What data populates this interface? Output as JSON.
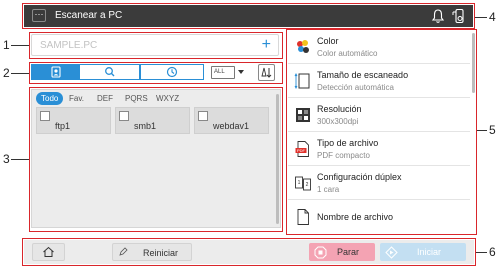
{
  "header": {
    "menu_glyph": "···",
    "title": "Escanear  a  PC"
  },
  "destination": {
    "value": "SAMPLE.PC",
    "add_glyph": "+"
  },
  "toolbar": {
    "tabs": [
      {
        "icon": "address-book-icon",
        "active": true
      },
      {
        "icon": "search-icon",
        "active": false
      },
      {
        "icon": "history-clock-icon",
        "active": false
      }
    ],
    "filter_dropdown": "ALL"
  },
  "filters": [
    "Todo",
    "Fav.",
    "DEF",
    "PQRS",
    "WXYZ"
  ],
  "destinations": [
    "ftp1",
    "smb1",
    "webdav1"
  ],
  "settings": [
    {
      "icon": "color-icon",
      "title": "Color",
      "value": "Color automático"
    },
    {
      "icon": "scan-size-icon",
      "title": "Tamaño de escaneado",
      "value": "Detección automática"
    },
    {
      "icon": "resolution-icon",
      "title": "Resolución",
      "value": "300x300dpi"
    },
    {
      "icon": "pdf-file-icon",
      "title": "Tipo de archivo",
      "value": "PDF compacto"
    },
    {
      "icon": "duplex-icon",
      "title": "Configuración dúplex",
      "value": "1 cara"
    },
    {
      "icon": "document-icon",
      "title": "Nombre de archivo",
      "value": ""
    }
  ],
  "bottom": {
    "home_icon": "home-icon",
    "reset_label": "Reiniciar",
    "stop_label": "Parar",
    "start_label": "Iniciar"
  },
  "callouts": [
    "1",
    "2",
    "3",
    "4",
    "5",
    "6"
  ],
  "colors": {
    "accent": "#2a8fd6",
    "stop": "#f4a3b3",
    "start": "#c3dff2",
    "frame": "#d9262b",
    "header_bg": "#3b3b3b"
  }
}
